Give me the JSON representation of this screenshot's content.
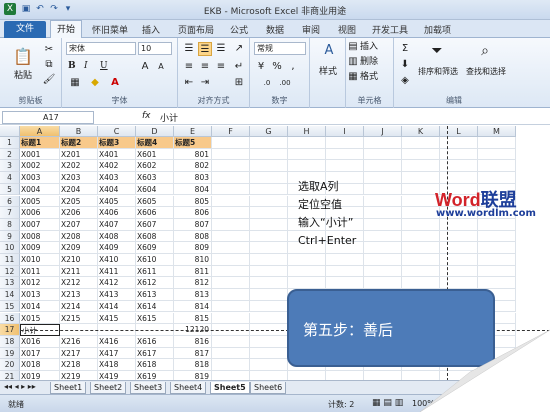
{
  "title": "EKB - Microsoft Excel 非商业用途",
  "tabs": {
    "file": "文件",
    "home": "开始",
    "others": [
      "怀旧菜单",
      "插入",
      "页面布局",
      "公式",
      "数据",
      "审阅",
      "视图",
      "开发工具",
      "加载项"
    ]
  },
  "ribbon": {
    "paste": "粘贴",
    "clipboard": "剪贴板",
    "font_name": "宋体",
    "font_size": "10",
    "font_group": "字体",
    "align_group": "对齐方式",
    "number_format": "常规",
    "number_group": "数字",
    "style": "样式",
    "insert": "插入",
    "delete": "删除",
    "format": "格式",
    "cells_group": "单元格",
    "sort": "排序和筛选",
    "find": "查找和选择",
    "edit_group": "编辑",
    "bold": "B",
    "italic": "I",
    "underline": "U"
  },
  "formula_bar": {
    "name_box": "A17",
    "fx": "fx",
    "content": "小计"
  },
  "columns": [
    "A",
    "B",
    "C",
    "D",
    "E",
    "F",
    "G",
    "H",
    "I",
    "J",
    "K",
    "L",
    "M"
  ],
  "rows": [
    {
      "n": "1",
      "a": "标题1",
      "b": "标题2",
      "c": "标题3",
      "d": "标题4",
      "e": "标题5",
      "hdr": true
    },
    {
      "n": "2",
      "a": "X001",
      "b": "X201",
      "c": "X401",
      "d": "X601",
      "e": "801"
    },
    {
      "n": "3",
      "a": "X002",
      "b": "X202",
      "c": "X402",
      "d": "X602",
      "e": "802"
    },
    {
      "n": "4",
      "a": "X003",
      "b": "X203",
      "c": "X403",
      "d": "X603",
      "e": "803"
    },
    {
      "n": "5",
      "a": "X004",
      "b": "X204",
      "c": "X404",
      "d": "X604",
      "e": "804"
    },
    {
      "n": "6",
      "a": "X005",
      "b": "X205",
      "c": "X405",
      "d": "X605",
      "e": "805"
    },
    {
      "n": "7",
      "a": "X006",
      "b": "X206",
      "c": "X406",
      "d": "X606",
      "e": "806"
    },
    {
      "n": "8",
      "a": "X007",
      "b": "X207",
      "c": "X407",
      "d": "X607",
      "e": "807"
    },
    {
      "n": "9",
      "a": "X008",
      "b": "X208",
      "c": "X408",
      "d": "X608",
      "e": "808"
    },
    {
      "n": "10",
      "a": "X009",
      "b": "X209",
      "c": "X409",
      "d": "X609",
      "e": "809"
    },
    {
      "n": "11",
      "a": "X010",
      "b": "X210",
      "c": "X410",
      "d": "X610",
      "e": "810"
    },
    {
      "n": "12",
      "a": "X011",
      "b": "X211",
      "c": "X411",
      "d": "X611",
      "e": "811"
    },
    {
      "n": "13",
      "a": "X012",
      "b": "X212",
      "c": "X412",
      "d": "X612",
      "e": "812"
    },
    {
      "n": "14",
      "a": "X013",
      "b": "X213",
      "c": "X413",
      "d": "X613",
      "e": "813"
    },
    {
      "n": "15",
      "a": "X014",
      "b": "X214",
      "c": "X414",
      "d": "X614",
      "e": "814"
    },
    {
      "n": "16",
      "a": "X015",
      "b": "X215",
      "c": "X415",
      "d": "X615",
      "e": "815"
    },
    {
      "n": "17",
      "a": "小计",
      "b": "",
      "c": "",
      "d": "",
      "e": "12120"
    },
    {
      "n": "18",
      "a": "X016",
      "b": "X216",
      "c": "X416",
      "d": "X616",
      "e": "816"
    },
    {
      "n": "19",
      "a": "X017",
      "b": "X217",
      "c": "X417",
      "d": "X617",
      "e": "817"
    },
    {
      "n": "20",
      "a": "X018",
      "b": "X218",
      "c": "X418",
      "d": "X618",
      "e": "818"
    },
    {
      "n": "21",
      "a": "X019",
      "b": "X219",
      "c": "X419",
      "d": "X619",
      "e": "819"
    }
  ],
  "sheets": [
    "Sheet1",
    "Sheet2",
    "Sheet3",
    "Sheet4",
    "Sheet5",
    "Sheet6"
  ],
  "active_sheet": "Sheet5",
  "status": {
    "ready": "就绪",
    "count": "计数: 2",
    "zoom": "100%"
  },
  "instructions": [
    "选取A列",
    "定位空值",
    "输入“小计”",
    "Ctrl+Enter"
  ],
  "logo": {
    "word": "Word",
    "cn": "联盟",
    "url": "www.wordlm.com"
  },
  "callout": "第五步：善后"
}
